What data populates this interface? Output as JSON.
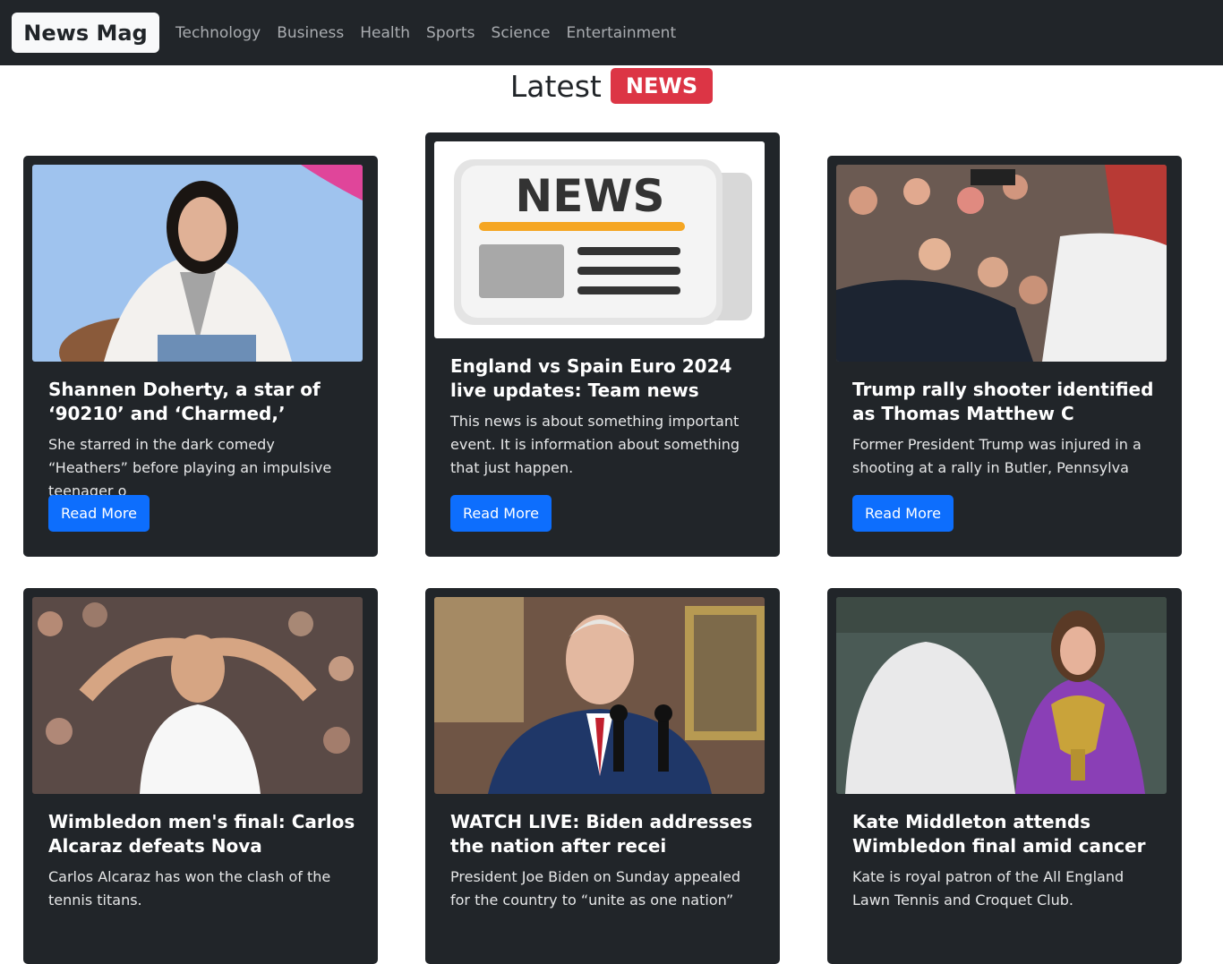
{
  "navbar": {
    "brand": "News Mag",
    "links": [
      "Technology",
      "Business",
      "Health",
      "Sports",
      "Science",
      "Entertainment"
    ]
  },
  "heading": {
    "text": "Latest",
    "badge": "NEWS"
  },
  "cards": [
    {
      "title": "Shannen Doherty, a star of ‘90210’ and ‘Charmed,’",
      "text": "She starred in the dark comedy “Heathers” before playing an impulsive teenager o",
      "button": "Read More",
      "image": "shannen-doherty-photo"
    },
    {
      "title": "England vs Spain Euro 2024 live updates: Team news",
      "text": "This news is about something important event. It is information about something that just happen.",
      "button": "Read More",
      "image": "news-newspaper-icon",
      "image_text": "NEWS"
    },
    {
      "title": "Trump rally shooter identified as Thomas Matthew C",
      "text": "Former President Trump was injured in a shooting at a rally in Butler, Pennsylva",
      "button": "Read More",
      "image": "trump-rally-photo"
    },
    {
      "title": "Wimbledon men's final: Carlos Alcaraz defeats Nova",
      "text": "Carlos Alcaraz has won the clash of the tennis titans.",
      "button": "Read More",
      "image": "carlos-alcaraz-photo"
    },
    {
      "title": "WATCH LIVE: Biden addresses the nation after recei",
      "text": "President Joe Biden on Sunday appealed for the country to “unite as one nation”",
      "button": "Read More",
      "image": "biden-address-photo"
    },
    {
      "title": "Kate Middleton attends Wimbledon final amid cancer",
      "text": "Kate is royal patron of the All England Lawn Tennis and Croquet Club.",
      "button": "Read More",
      "image": "kate-middleton-photo"
    }
  ],
  "colors": {
    "navbar": "#212529",
    "card": "#212529",
    "badge": "#dc3545",
    "button": "#0d6efd"
  }
}
